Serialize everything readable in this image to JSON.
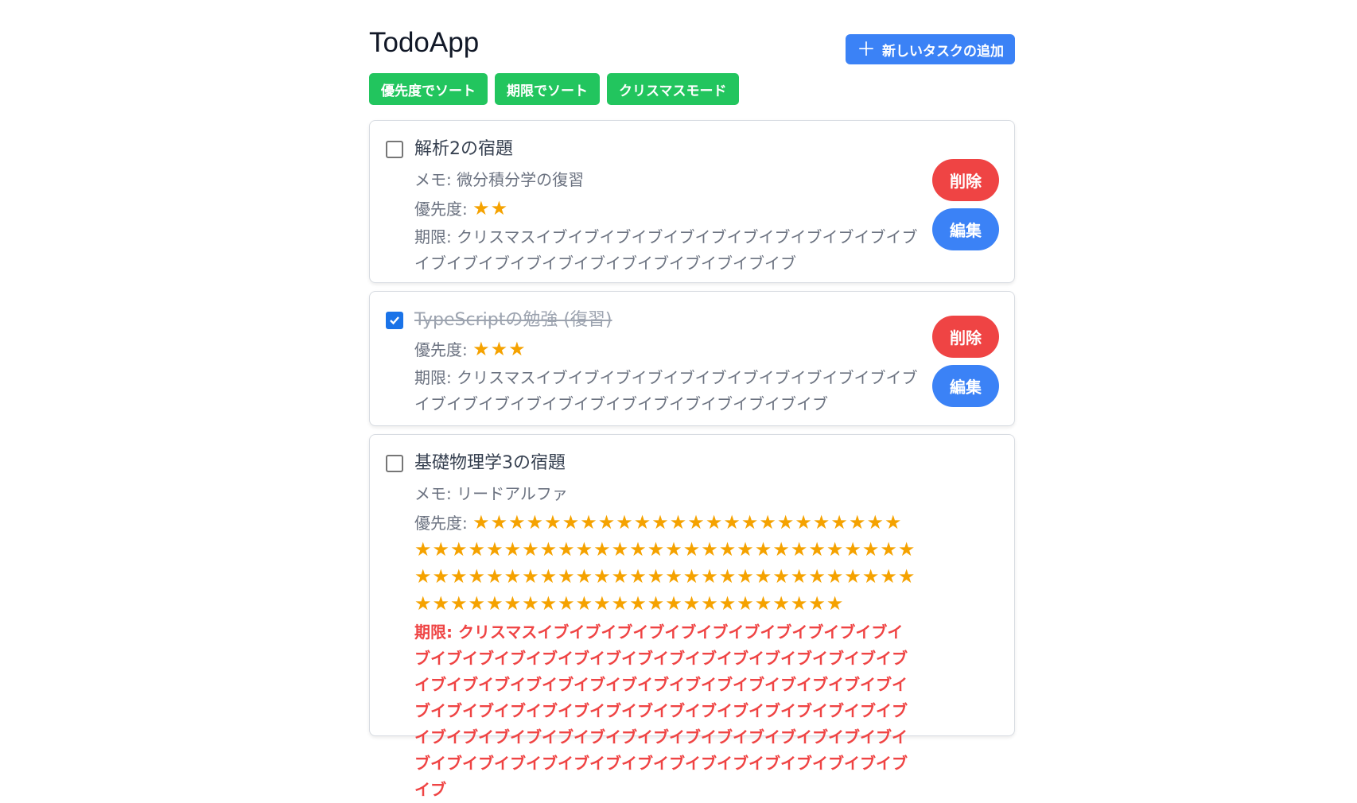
{
  "header": {
    "title": "TodoApp",
    "add_button_label": "新しいタスクの追加",
    "add_button_icon": "plus-icon"
  },
  "sort_bar": {
    "priority_sort_label": "優先度でソート",
    "deadline_sort_label": "期限でソート",
    "christmas_mode_label": "クリスマスモード"
  },
  "colors": {
    "primary": "#3b82f6",
    "success": "#22c55e",
    "danger": "#ef4444",
    "star": "#f5a200"
  },
  "tasks": [
    {
      "title": "解析2の宿題",
      "completed": false,
      "memo": "メモ: 微分積分学の復習",
      "priority_label": "優先度:",
      "priority_stars": 2,
      "stars_text": "★★",
      "due": "期限: クリスマスイブイブイブイブイブイブイブイブイブイブイブイブイブイブイブイブイブイブイブイブイブイブイブイブ",
      "overdue": false,
      "delete_label": "削除",
      "edit_label": "編集"
    },
    {
      "title": "TypeScriptの勉強 (復習)",
      "completed": true,
      "memo": "",
      "priority_label": "優先度:",
      "priority_stars": 3,
      "stars_text": "★★★",
      "due": "期限: クリスマスイブイブイブイブイブイブイブイブイブイブイブイブイブイブイブイブイブイブイブイブイブイブイブイブイブ",
      "overdue": false,
      "delete_label": "削除",
      "edit_label": "編集"
    },
    {
      "title": "基礎物理学3の宿題",
      "completed": false,
      "memo": "メモ: リードアルファ",
      "priority_label": "優先度:",
      "stars_text": "★★★★★★★★★★★★★★★★★★★★★★★★★★★★★★★★★★★★★★★★★★★★★★★★★★★★★★★★★★★★★★★★★★★★★★★★★★★★★★★★★★★★★★★★★★★★★★★★★★★★★★★★",
      "due": "期限: クリスマスイブイブイブイブイブイブイブイブイブイブイブイブイブイブイブイブイブイブイブイブイブイブイブイブイブイブイブイブイブイブイブイブイブイブイブイブイブイブイブイブイブイブイブイブイブイブイブイブイブイブイブイブイブイブイブイブイブイブイブイブイブイブイブイブイブイブイブイブイブイブイブイブイブイブイブイブイブイブイブイブイブイブイブイブイブイブイブイブイブイブ",
      "overdue": true,
      "delete_label": "削除",
      "edit_label": "編集"
    }
  ]
}
